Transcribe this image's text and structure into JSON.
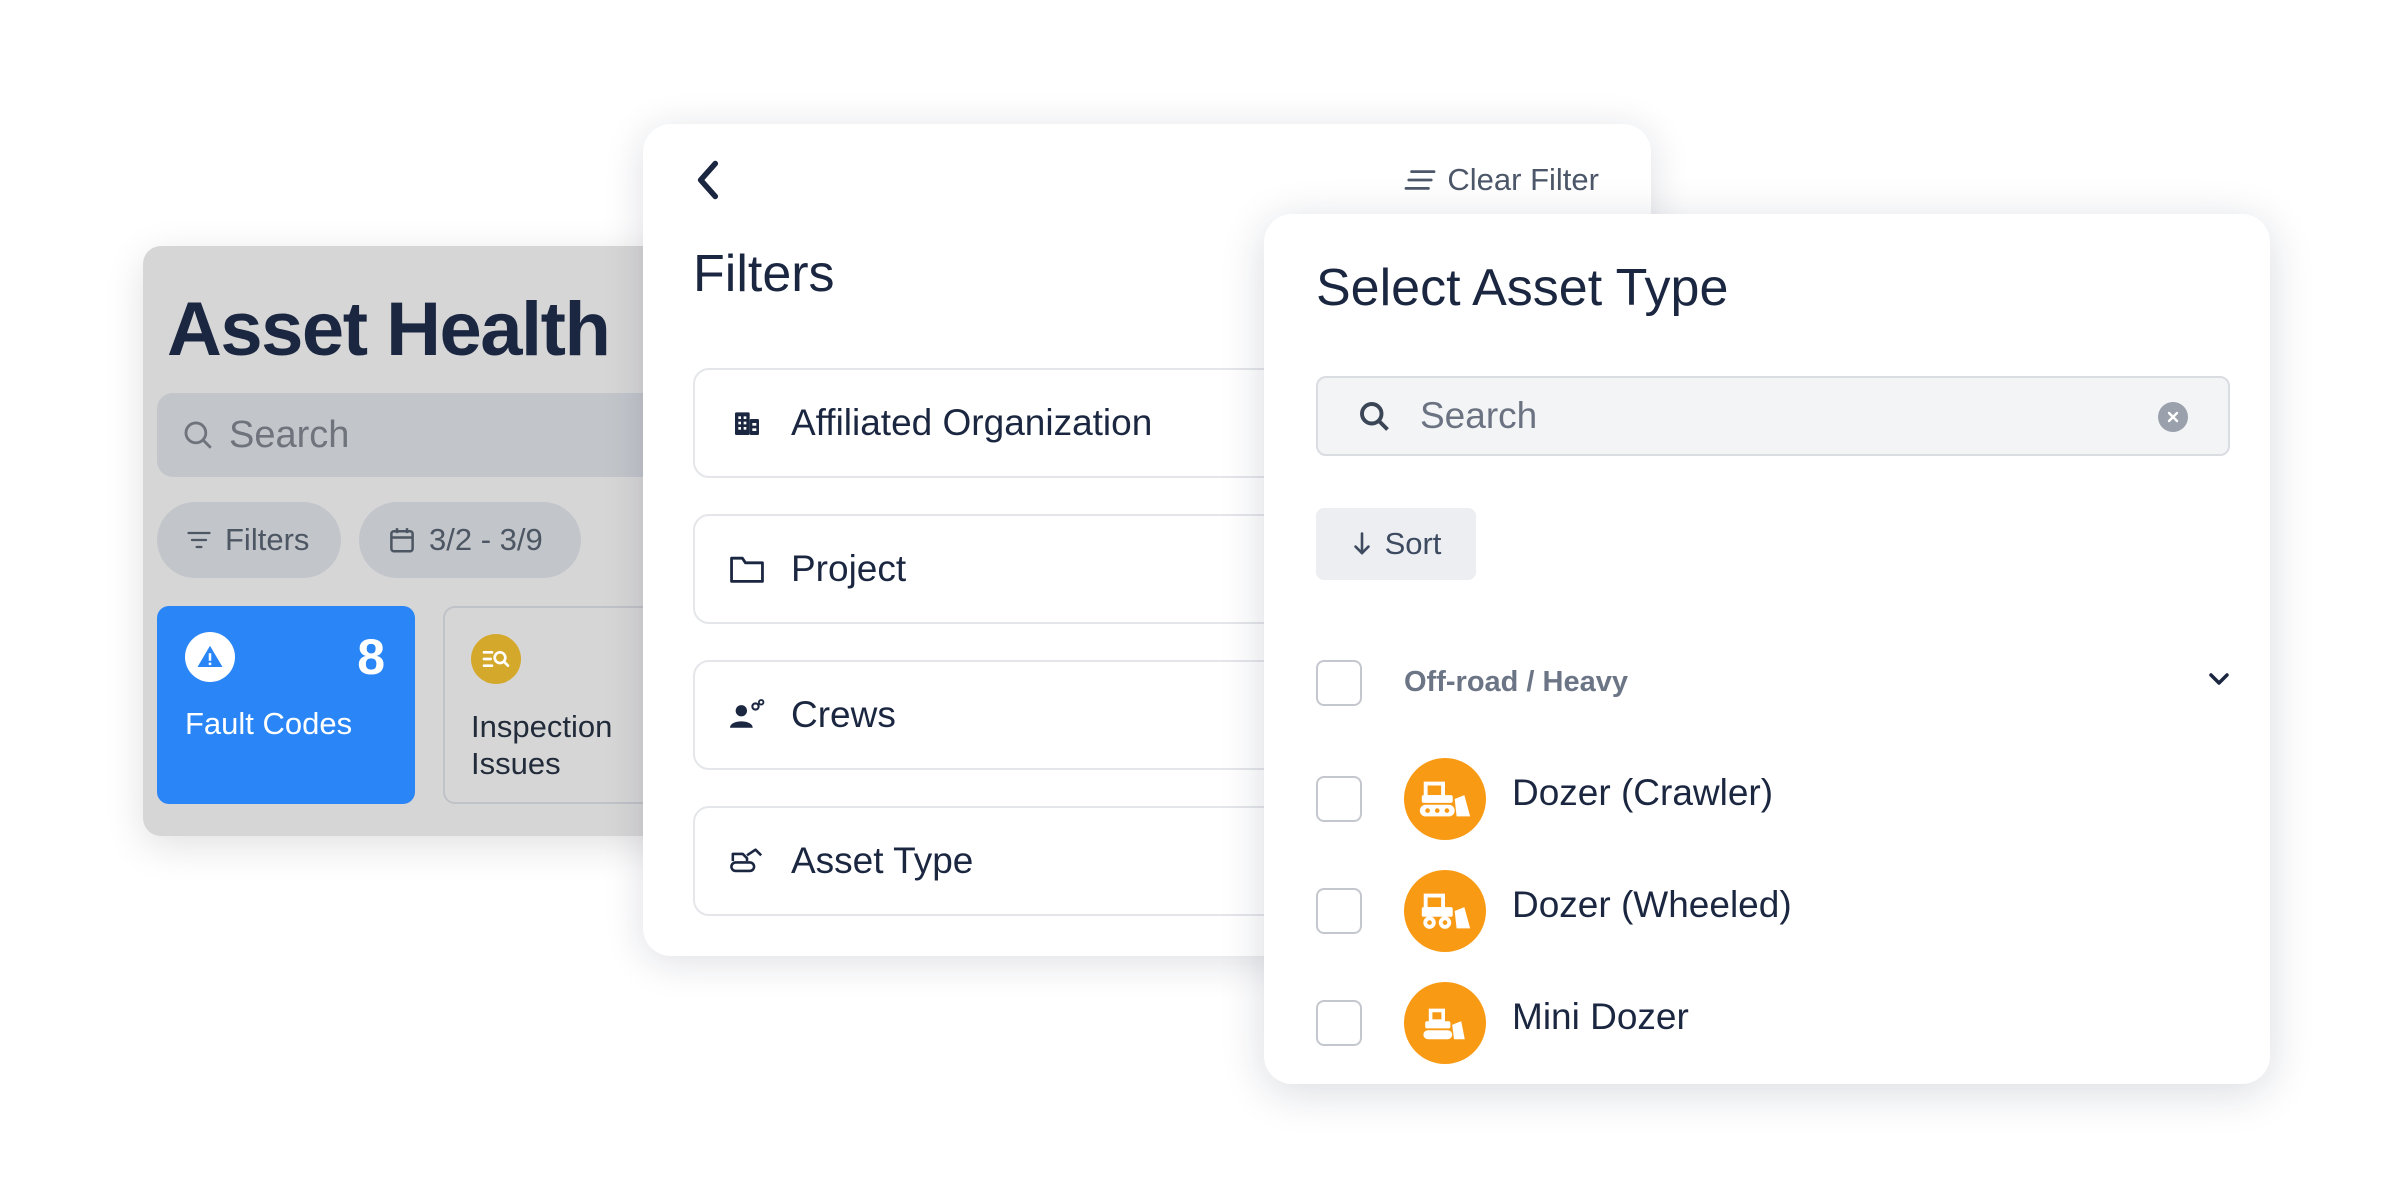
{
  "asset_health": {
    "title": "Asset Health",
    "search_placeholder": "Search",
    "chips": {
      "filters": "Filters",
      "date_range": "3/2 - 3/9"
    },
    "tiles": [
      {
        "label": "Fault Codes",
        "count": "8",
        "color": "#2a86f7"
      },
      {
        "label": "Inspection Issues",
        "color": "#d4a82a"
      }
    ]
  },
  "filters_panel": {
    "title": "Filters",
    "clear_label": "Clear Filter",
    "rows": [
      {
        "label": "Affiliated Organization",
        "icon": "building-icon"
      },
      {
        "label": "Project",
        "icon": "folder-icon"
      },
      {
        "label": "Crews",
        "icon": "crew-icon"
      },
      {
        "label": "Asset Type",
        "icon": "equipment-icon"
      }
    ]
  },
  "asset_type_panel": {
    "title": "Select Asset Type",
    "search_placeholder": "Search",
    "sort_label": "Sort",
    "group": {
      "label": "Off-road / Heavy",
      "checked": false
    },
    "items": [
      {
        "label": "Dozer (Crawler)",
        "icon": "dozer-crawler-icon",
        "checked": false
      },
      {
        "label": "Dozer (Wheeled)",
        "icon": "dozer-wheeled-icon",
        "checked": false
      },
      {
        "label": "Mini Dozer",
        "icon": "mini-dozer-icon",
        "checked": false
      }
    ],
    "accent_color": "#f99a14"
  }
}
